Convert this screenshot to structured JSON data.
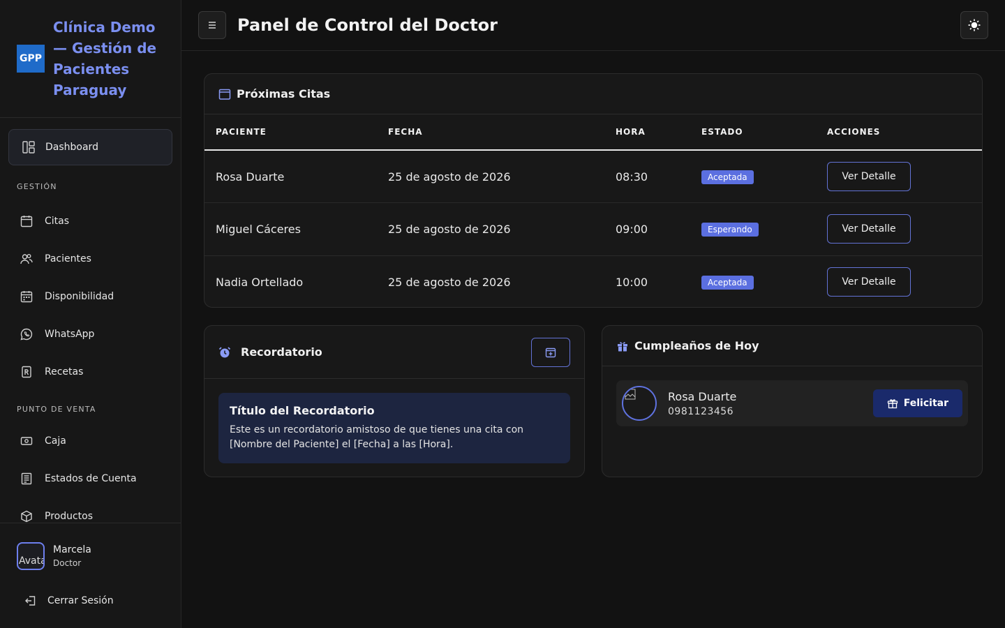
{
  "brand": {
    "logo": "GPP",
    "name": "Clínica Demo — Gestión de Pacientes Paraguay",
    "accent": "#7b8ff0"
  },
  "nav": {
    "active": {
      "label": "Dashboard",
      "icon": "dashboard-icon"
    },
    "sections": [
      {
        "title": "GESTIÓN",
        "items": [
          {
            "label": "Citas",
            "icon": "calendar-icon"
          },
          {
            "label": "Pacientes",
            "icon": "users-icon"
          },
          {
            "label": "Disponibilidad",
            "icon": "calendar-grid-icon"
          },
          {
            "label": "WhatsApp",
            "icon": "whatsapp-icon"
          },
          {
            "label": "Recetas",
            "icon": "prescription-icon"
          }
        ]
      },
      {
        "title": "PUNTO DE VENTA",
        "items": [
          {
            "label": "Caja",
            "icon": "cash-icon"
          },
          {
            "label": "Estados de Cuenta",
            "icon": "ledger-icon"
          },
          {
            "label": "Productos",
            "icon": "box-icon"
          }
        ]
      }
    ]
  },
  "user": {
    "name": "Marcela",
    "role": "Doctor",
    "avatar_alt": "Avatar"
  },
  "logout_label": "Cerrar Sesión",
  "header": {
    "title": "Panel de Control del Doctor"
  },
  "appointments": {
    "title": "Próximas Citas",
    "columns": [
      "PACIENTE",
      "FECHA",
      "HORA",
      "ESTADO",
      "ACCIONES"
    ],
    "rows": [
      {
        "patient": "Rosa Duarte",
        "date": "25 de agosto de 2026",
        "time": "08:30",
        "status": "Aceptada",
        "action": "Ver Detalle"
      },
      {
        "patient": "Miguel Cáceres",
        "date": "25 de agosto de 2026",
        "time": "09:00",
        "status": "Esperando",
        "action": "Ver Detalle"
      },
      {
        "patient": "Nadia Ortellado",
        "date": "25 de agosto de 2026",
        "time": "10:00",
        "status": "Aceptada",
        "action": "Ver Detalle"
      }
    ],
    "badge_color": "#5b6fe0"
  },
  "reminder": {
    "title": "Recordatorio",
    "box_title": "Título del Recordatorio",
    "box_text": "Este es un recordatorio amistoso de que tienes una cita con [Nombre del Paciente] el [Fecha] a las [Hora]."
  },
  "birthdays": {
    "title": "Cumpleaños de Hoy",
    "items": [
      {
        "name": "Rosa Duarte",
        "phone": "0981123456",
        "action": "Felicitar"
      }
    ]
  }
}
